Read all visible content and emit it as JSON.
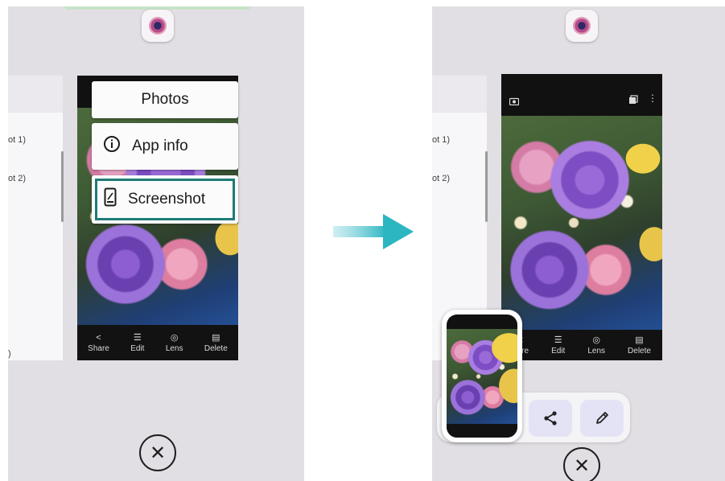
{
  "left": {
    "partial_labels": [
      "ot 1)",
      "ot 2)",
      ")"
    ],
    "menu": {
      "title": "Photos",
      "app_info_label": "App info",
      "screenshot_label": "Screenshot"
    },
    "toolbar": [
      "Share",
      "Edit",
      "Lens",
      "Delete"
    ]
  },
  "right": {
    "partial_labels": [
      "ot 1)",
      "ot 2)"
    ],
    "toolbar": [
      "hare",
      "Edit",
      "Lens",
      "Delete"
    ]
  },
  "close_glyph": "✕",
  "colors": {
    "panel_bg": "#e2dfe4",
    "highlight_border": "#1f7b78",
    "arrow": "#2cb6c2",
    "action_button_bg": "#e4e3f6"
  },
  "icons": [
    "camera-app-icon",
    "info-icon",
    "screenshot-icon",
    "share-icon",
    "edit-icon",
    "lens-icon",
    "delete-icon",
    "close-icon",
    "pencil-icon"
  ]
}
